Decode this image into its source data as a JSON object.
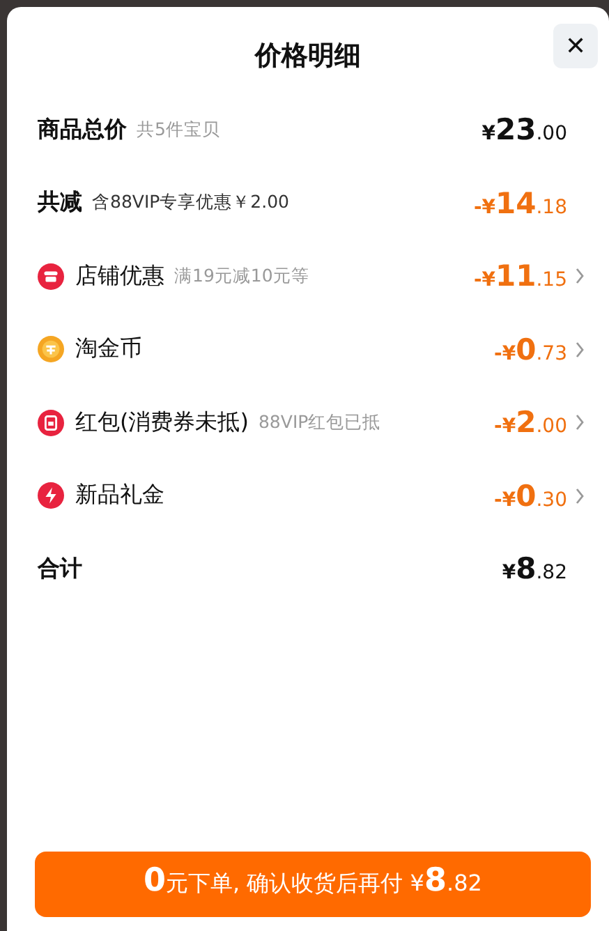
{
  "title": "价格明细",
  "close": "✕",
  "rows": [
    {
      "kind": "plain",
      "label": "商品总价",
      "note": "共5件宝贝",
      "highlight": false,
      "chevron": false,
      "price": {
        "sign": "¥",
        "whole": "23",
        "cents": ".00"
      }
    },
    {
      "kind": "plain",
      "label": "共减",
      "note": "含88VIP专享优惠￥2.00",
      "highlight": true,
      "chevron": false,
      "price": {
        "sign": "-¥",
        "whole": "14",
        "cents": ".18"
      }
    },
    {
      "kind": "store",
      "label": "店铺优惠",
      "note": "满19元减10元等",
      "highlight": true,
      "chevron": true,
      "price": {
        "sign": "-¥",
        "whole": "11",
        "cents": ".15"
      }
    },
    {
      "kind": "coin",
      "label": "淘金币",
      "highlight": true,
      "chevron": true,
      "price": {
        "sign": "-¥",
        "whole": "0",
        "cents": ".73"
      }
    },
    {
      "kind": "packet",
      "label": "红包(消费券未抵)",
      "note": "88VIP红包已抵",
      "highlight": true,
      "chevron": true,
      "price": {
        "sign": "-¥",
        "whole": "2",
        "cents": ".00"
      }
    },
    {
      "kind": "bolt",
      "label": "新品礼金",
      "highlight": true,
      "chevron": true,
      "price": {
        "sign": "-¥",
        "whole": "0",
        "cents": ".30"
      }
    },
    {
      "kind": "plain",
      "label": "合计",
      "highlight": false,
      "chevron": false,
      "price": {
        "sign": "¥",
        "whole": "8",
        "cents": ".82"
      }
    }
  ],
  "button": {
    "lead": "0",
    "text": "元下单, 确认收货后再付 ¥",
    "whole": "8",
    "cents": ".82"
  }
}
